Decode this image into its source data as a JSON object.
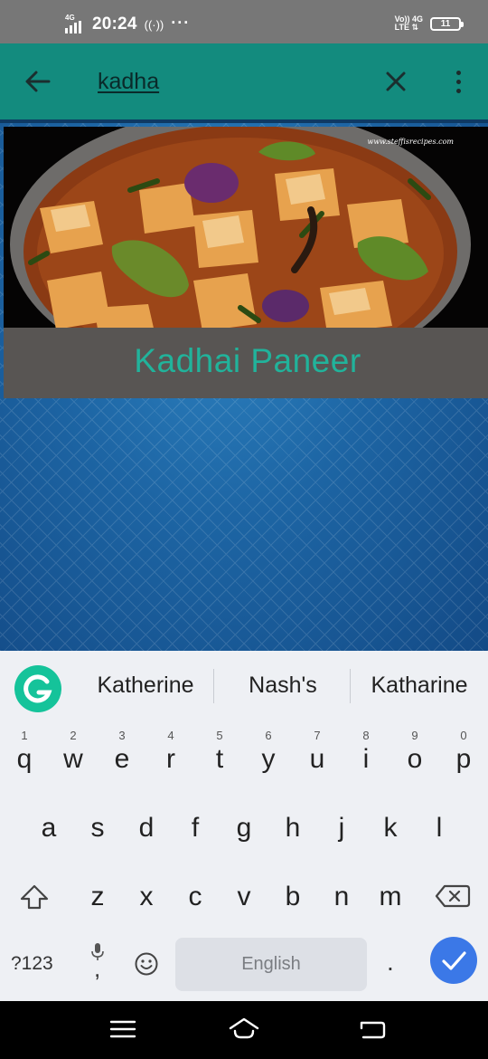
{
  "status_bar": {
    "network": "4G",
    "time": "20:24",
    "hotspot_icon": "((·))",
    "more": "···",
    "volte_line1": "Vo)) 4G",
    "volte_line2": "LTE ⇅",
    "battery": "11"
  },
  "app_bar": {
    "search_query": "kadha"
  },
  "result": {
    "title": "Kadhai Paneer",
    "watermark": "www.steffisrecipes.com"
  },
  "keyboard": {
    "suggestions": [
      "Katherine",
      "Nash's",
      "Katharine"
    ],
    "row1": [
      {
        "ch": "q",
        "num": "1"
      },
      {
        "ch": "w",
        "num": "2"
      },
      {
        "ch": "e",
        "num": "3"
      },
      {
        "ch": "r",
        "num": "4"
      },
      {
        "ch": "t",
        "num": "5"
      },
      {
        "ch": "y",
        "num": "6"
      },
      {
        "ch": "u",
        "num": "7"
      },
      {
        "ch": "i",
        "num": "8"
      },
      {
        "ch": "o",
        "num": "9"
      },
      {
        "ch": "p",
        "num": "0"
      }
    ],
    "row2": [
      "a",
      "s",
      "d",
      "f",
      "g",
      "h",
      "j",
      "k",
      "l"
    ],
    "row3": [
      "z",
      "x",
      "c",
      "v",
      "b",
      "n",
      "m"
    ],
    "symbols_label": "?123",
    "mic_comma": ",",
    "space_label": "English",
    "period": "."
  },
  "colors": {
    "app_bar": "#138b7e",
    "title_text": "#21b39b",
    "enter_key": "#3b78e7",
    "grammarly": "#15c39a"
  }
}
